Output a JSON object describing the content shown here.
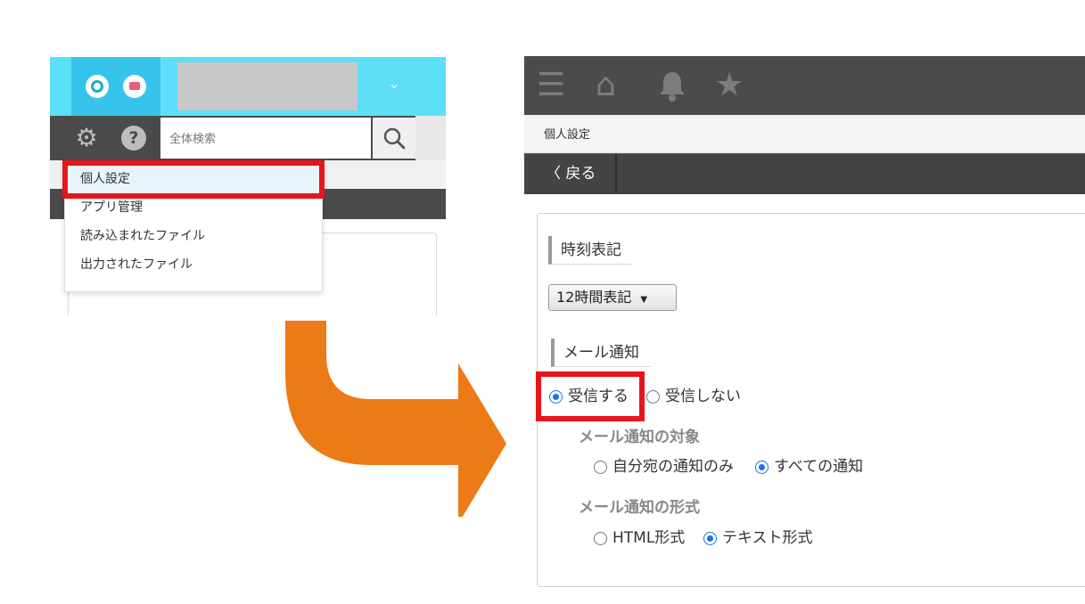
{
  "left": {
    "search_placeholder": "全体検索",
    "menu_items": [
      "個人設定",
      "アプリ管理",
      "読み込まれたファイル",
      "出力されたファイル"
    ]
  },
  "right": {
    "breadcrumb": "個人設定",
    "back_label": "戻る",
    "time_section": {
      "heading": "時刻表記",
      "selected": "12時間表記"
    },
    "mail_section": {
      "heading": "メール通知",
      "receive_options": [
        "受信する",
        "受信しない"
      ],
      "target": {
        "heading": "メール通知の対象",
        "options": [
          "自分宛の通知のみ",
          "すべての通知"
        ]
      },
      "format": {
        "heading": "メール通知の形式",
        "options": [
          "HTML形式",
          "テキスト形式"
        ]
      }
    }
  },
  "colors": {
    "highlight": "#e8151c",
    "arrow": "#ec7a16",
    "cyan": "#5ddff8",
    "radio_on": "#1a73e8"
  }
}
